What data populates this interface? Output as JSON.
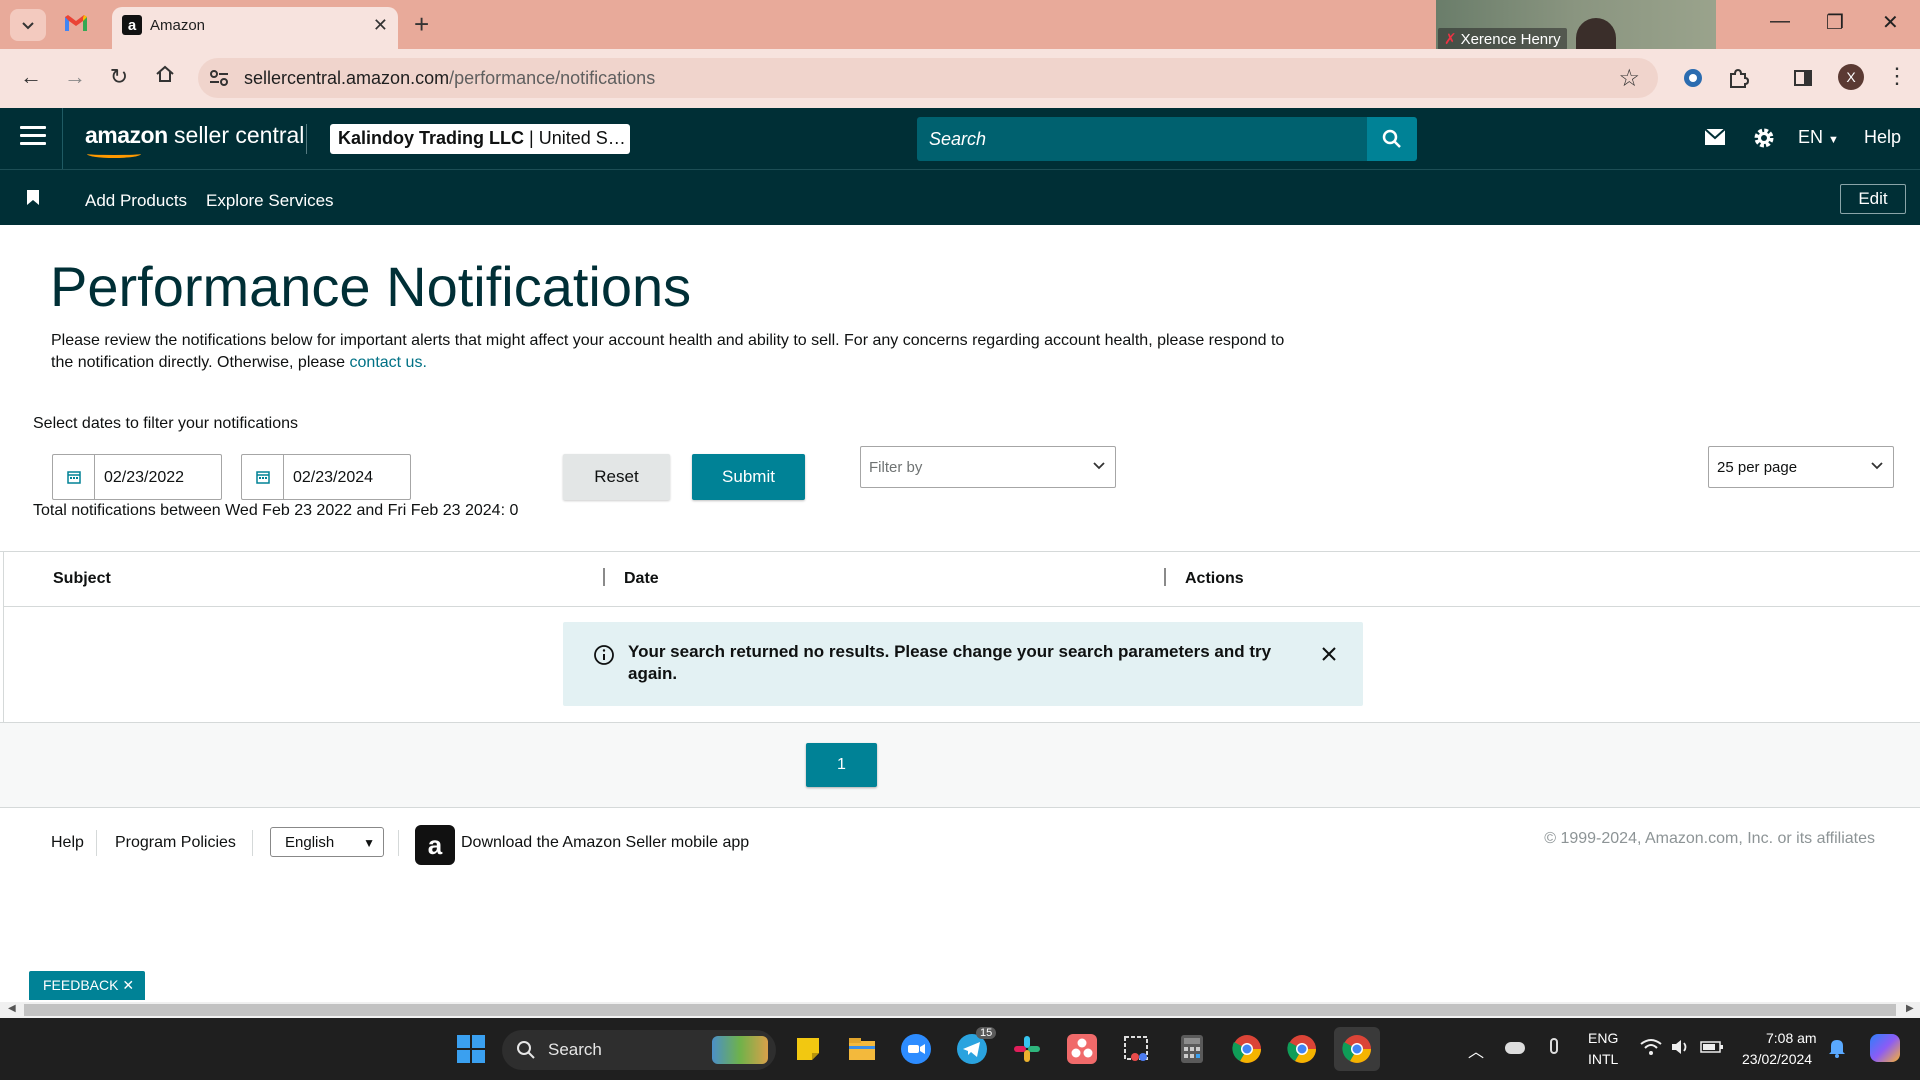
{
  "browser": {
    "tab_title": "Amazon",
    "url_host": "sellercentral.amazon.com",
    "url_path": "/performance/notifications",
    "profile_initial": "X",
    "zoom_participant": "Xerence Henry"
  },
  "header": {
    "logo_bold": "amazon",
    "logo_rest": " seller central",
    "account_name": "Kalindoy Trading LLC",
    "account_region": " | United S…",
    "search_placeholder": "Search",
    "language": "EN",
    "help": "Help"
  },
  "subnav": {
    "items": [
      "Add Products",
      "Explore Services"
    ],
    "edit": "Edit"
  },
  "page": {
    "title": "Performance Notifications",
    "description": "Please review the notifications below for important alerts that might affect your account health and ability to sell. For any concerns regarding account health, please respond to the notification directly. Otherwise, please ",
    "contact_link": "contact us.",
    "filter_label": "Select dates to filter your notifications",
    "start_date": "02/23/2022",
    "end_date": "02/23/2024",
    "reset": "Reset",
    "submit": "Submit",
    "filter_by": "Filter by",
    "per_page": "25 per page",
    "total": "Total notifications between Wed Feb 23 2022 and Fri Feb 23 2024: 0"
  },
  "table": {
    "columns": [
      "Subject",
      "Date",
      "Actions"
    ],
    "empty_message": "Your search returned no results. Please change your search parameters and try again."
  },
  "pagination": {
    "current": "1"
  },
  "footer": {
    "help": "Help",
    "policies": "Program Policies",
    "language": "English",
    "app_link": "Download the Amazon Seller mobile app",
    "copyright": "© 1999-2024, Amazon.com, Inc. or its affiliates"
  },
  "feedback": "FEEDBACK ✕",
  "taskbar": {
    "search": "Search",
    "telegram_badge": "15",
    "lang_top": "ENG",
    "lang_bottom": "INTL",
    "time": "7:08 am",
    "date": "23/02/2024"
  },
  "colors": {
    "header_bg": "#002f36",
    "accent": "#008296",
    "tab_strip": "#e8aa9a"
  }
}
